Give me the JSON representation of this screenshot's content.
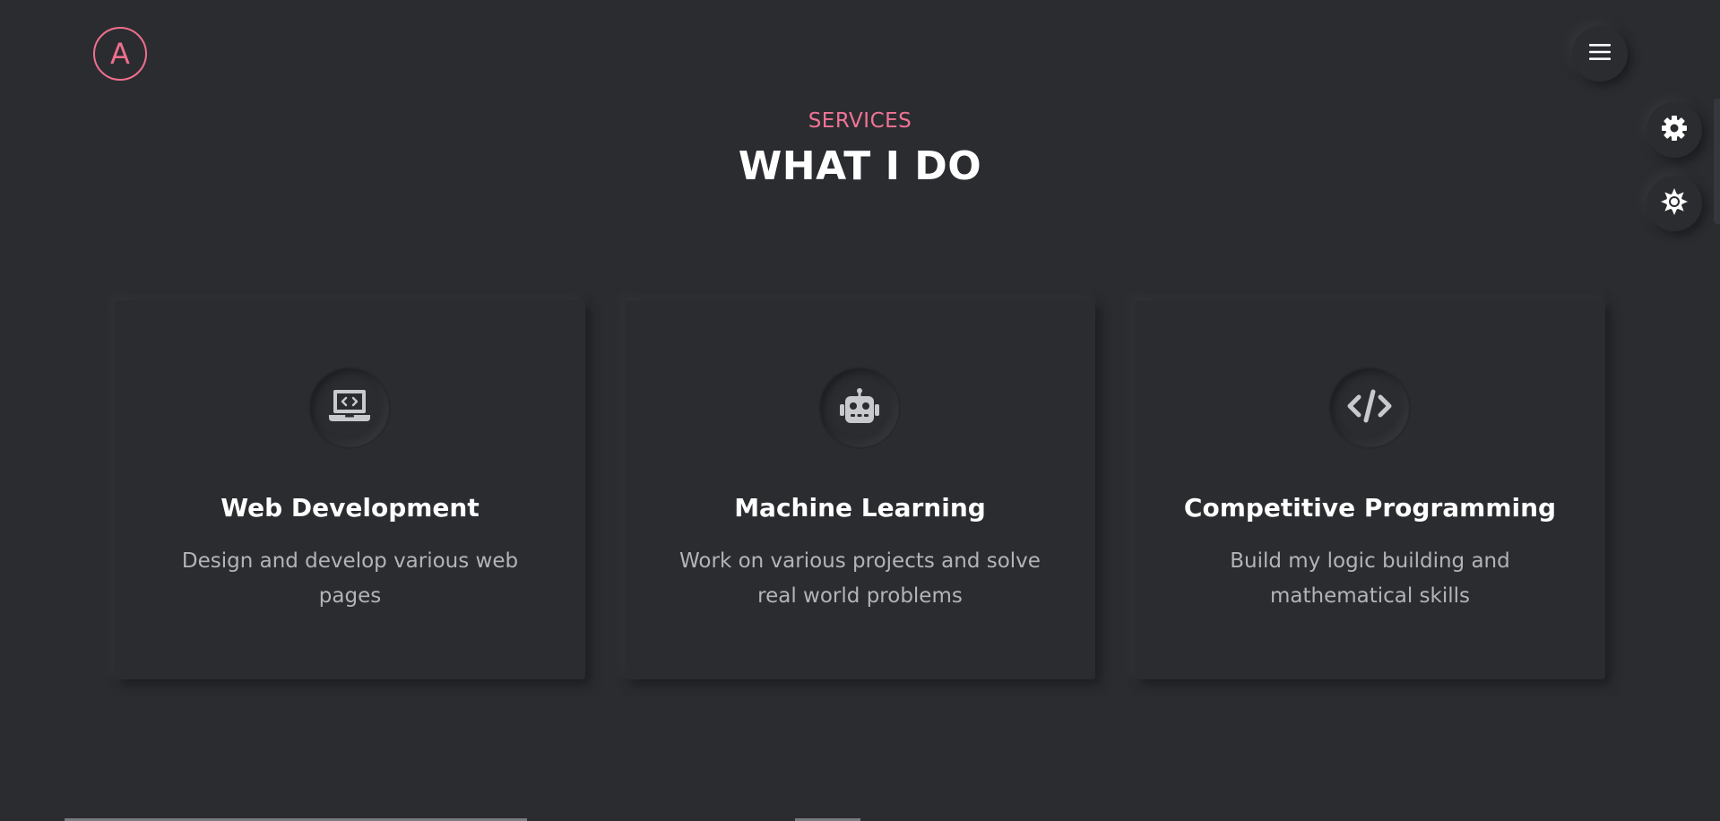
{
  "brand": {
    "logo_letter": "A"
  },
  "header": {
    "menu_icon": "hamburger-menu-icon"
  },
  "side_controls": {
    "settings_icon": "gear-icon",
    "theme_icon": "sun-icon"
  },
  "section": {
    "eyebrow": "SERVICES",
    "title": "WHAT I DO"
  },
  "colors": {
    "background": "#2b2c30",
    "accent": "#ef6f8d",
    "title_text": "#ffffff",
    "body_text": "#b3b4b8",
    "icon": "#c8c9cc"
  },
  "services": [
    {
      "icon": "laptop-code-icon",
      "title": "Web Development",
      "description": "Design and develop various web pages"
    },
    {
      "icon": "robot-icon",
      "title": "Machine Learning",
      "description": "Work on various projects and solve real world problems"
    },
    {
      "icon": "code-icon",
      "title": "Competitive Programming",
      "description": "Build my logic building and mathematical skills"
    }
  ]
}
